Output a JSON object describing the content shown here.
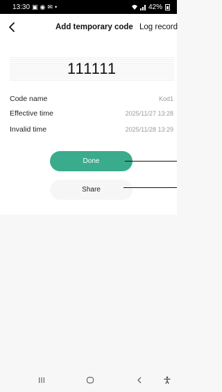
{
  "status_bar": {
    "time": "13:30",
    "battery": "42%",
    "left_icons": [
      "gallery-icon",
      "instagram-icon",
      "email-icon",
      "dot-icon"
    ],
    "right_icons": [
      "wifi-icon",
      "signal-icon",
      "battery-icon"
    ]
  },
  "header": {
    "title": "Add temporary code",
    "action_label": "Log record"
  },
  "code": {
    "value": "111111"
  },
  "details": [
    {
      "label": "Code name",
      "value": "Kod1"
    },
    {
      "label": "Effective time",
      "value": "2025/11/27 13:28"
    },
    {
      "label": "Invalid time",
      "value": "2025/11/28 13:29"
    }
  ],
  "buttons": {
    "done_label": "Done",
    "share_label": "Share"
  },
  "colors": {
    "accent": "#3aab8d",
    "status_bar_bg": "#000000",
    "page_bg": "#f7f7f7"
  },
  "bottom_nav": {
    "icons": [
      "recents-icon",
      "home-icon",
      "back-icon",
      "accessibility-icon"
    ]
  }
}
